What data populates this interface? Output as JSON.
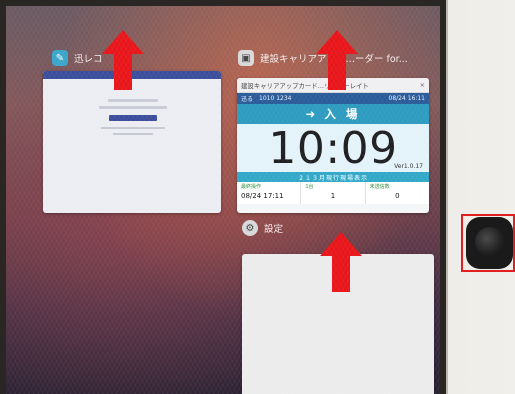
{
  "apps": {
    "left": {
      "label": "迅レコ",
      "icon": "record-app-icon",
      "icon_color": "#3aa6c9"
    },
    "center": {
      "label": "建設キャリアアップ…ーダー for...",
      "icon": "card-reader-app-icon",
      "icon_color": "#d9d9d9"
    },
    "bottom": {
      "label": "設定",
      "icon": "settings-gear-icon",
      "icon_color": "#d9d9d9"
    }
  },
  "clock_card": {
    "window_title": "建設キャリアアップカード…リーダーレイト",
    "close": "×",
    "info_left": "迅る",
    "info_mid": "1010 1234",
    "info_date": "08/24 16:11",
    "status": "入 場",
    "time": "10:09",
    "version": "Ver1.0.17",
    "banner": "２１３月現行現場表示",
    "stats": [
      {
        "label": "最終操作",
        "value": "08/24 17:11"
      },
      {
        "label": "1台",
        "value": "1"
      },
      {
        "label": "未送信数",
        "value": "0"
      }
    ]
  },
  "hardware": {
    "button": "home-button",
    "highlight_color": "#e21f1f"
  },
  "arrow_color": "#e8161a"
}
